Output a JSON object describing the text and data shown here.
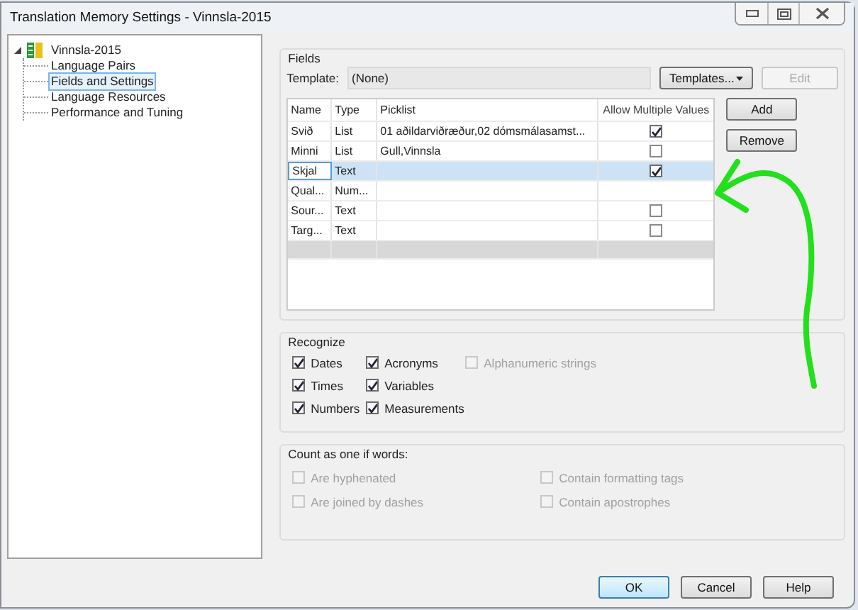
{
  "window": {
    "title": "Translation Memory Settings - Vinnsla-2015"
  },
  "tree": {
    "label": "Vinnsla-2015",
    "expanded": true,
    "children": [
      {
        "label": "Language Pairs",
        "selected": false
      },
      {
        "label": "Fields and Settings",
        "selected": true
      },
      {
        "label": "Language Resources",
        "selected": false
      },
      {
        "label": "Performance and Tuning",
        "selected": false
      }
    ]
  },
  "fields": {
    "title": "Fields",
    "template_label": "Template:",
    "template_value": "(None)",
    "templates_button": "Templates...",
    "edit_button": {
      "label": "Edit",
      "disabled": true
    },
    "columns": [
      "Name",
      "Type",
      "Picklist",
      "Allow Multiple Values"
    ],
    "rows": [
      {
        "name": "Svið",
        "type": "List",
        "picklist": "01 aðildarviðræður,02 dómsmálasamst...",
        "kind": "checkbox",
        "checked": true,
        "selected": false
      },
      {
        "name": "Minni",
        "type": "List",
        "picklist": "Gull,Vinnsla",
        "kind": "checkbox",
        "checked": false,
        "selected": false
      },
      {
        "name": "Skjal",
        "type": "Text",
        "picklist": "",
        "kind": "checkbox",
        "checked": true,
        "selected": true
      },
      {
        "name": "Qual...",
        "type": "Num...",
        "picklist": "",
        "kind": "none",
        "selected": false
      },
      {
        "name": "Sour...",
        "type": "Text",
        "picklist": "",
        "kind": "checkbox",
        "checked": false,
        "selected": false
      },
      {
        "name": "Targ...",
        "type": "Text",
        "picklist": "",
        "kind": "checkbox",
        "checked": false,
        "selected": false
      }
    ],
    "add_button": "Add",
    "remove_button": "Remove"
  },
  "recognize": {
    "title": "Recognize",
    "options": [
      {
        "label": "Dates",
        "checked": true,
        "disabled": false
      },
      {
        "label": "Times",
        "checked": true,
        "disabled": false
      },
      {
        "label": "Numbers",
        "checked": true,
        "disabled": false
      },
      {
        "label": "Acronyms",
        "checked": true,
        "disabled": false
      },
      {
        "label": "Variables",
        "checked": true,
        "disabled": false
      },
      {
        "label": "Measurements",
        "checked": true,
        "disabled": false
      },
      {
        "label": "Alphanumeric strings",
        "checked": false,
        "disabled": true
      }
    ]
  },
  "count_as_one": {
    "title": "Count as one if words:",
    "options": [
      {
        "label": "Are hyphenated",
        "checked": false,
        "disabled": true
      },
      {
        "label": "Are joined by dashes",
        "checked": false,
        "disabled": true
      },
      {
        "label": "Contain formatting tags",
        "checked": false,
        "disabled": true
      },
      {
        "label": "Contain apostrophes",
        "checked": false,
        "disabled": true
      }
    ]
  },
  "buttons": [
    "OK",
    "Cancel",
    "Help"
  ]
}
